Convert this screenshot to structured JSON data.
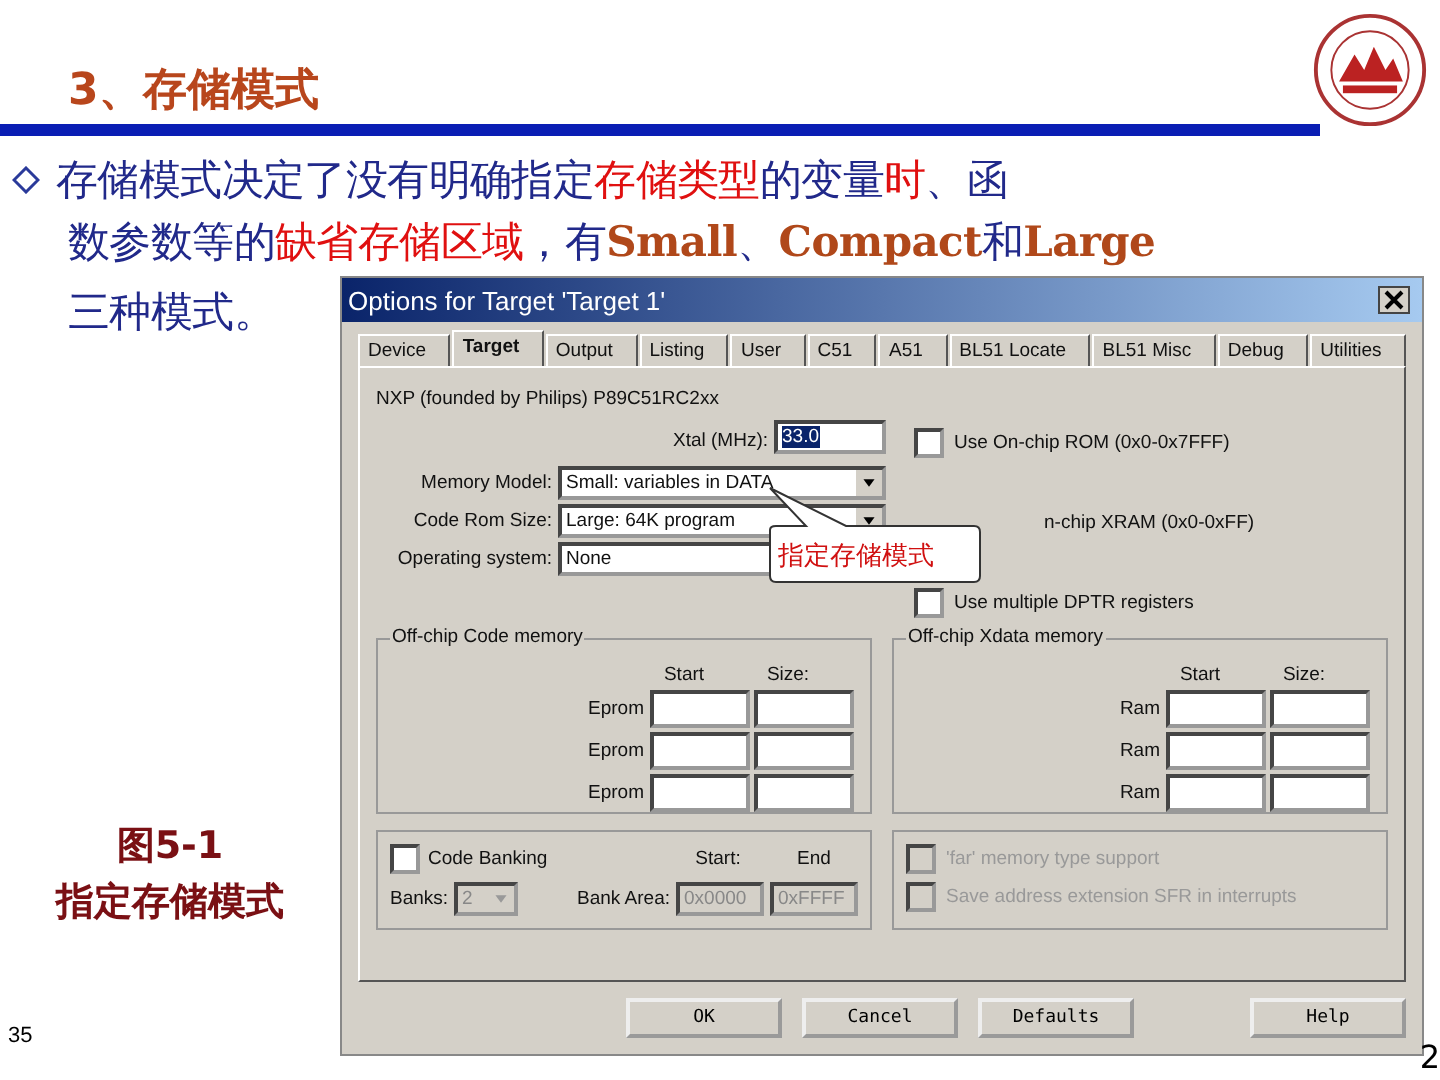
{
  "slide": {
    "title": "3、存储模式",
    "bullet_lines": [
      [
        {
          "kind": "plain",
          "text": "存储模式决定了没有明确指定"
        },
        {
          "kind": "red",
          "text": "存储类型"
        },
        {
          "kind": "plain",
          "text": "的变量"
        },
        {
          "kind": "red",
          "text": "时"
        },
        {
          "kind": "plain",
          "text": "、函"
        }
      ],
      [
        {
          "kind": "plain",
          "text": "数参数等的"
        },
        {
          "kind": "red",
          "text": "缺省存储区域"
        },
        {
          "kind": "plain",
          "text": "，有"
        },
        {
          "kind": "brown",
          "text": "Small"
        },
        {
          "kind": "plain",
          "text": "、"
        },
        {
          "kind": "brown",
          "text": "Compact"
        },
        {
          "kind": "plain",
          "text": "和"
        },
        {
          "kind": "brown",
          "text": "Large"
        }
      ],
      [
        {
          "kind": "plain",
          "text": "三种模式。"
        }
      ]
    ],
    "caption_lines": [
      "图5-1",
      "指定存储模式"
    ],
    "page_number": "35",
    "corner_number": "2"
  },
  "dialog": {
    "title": "Options for Target 'Target 1'",
    "tabs": [
      {
        "label": "Device",
        "selected": false
      },
      {
        "label": "Target",
        "selected": true
      },
      {
        "label": "Output",
        "selected": false
      },
      {
        "label": "Listing",
        "selected": false
      },
      {
        "label": "User",
        "selected": false
      },
      {
        "label": "C51",
        "selected": false
      },
      {
        "label": "A51",
        "selected": false
      },
      {
        "label": "BL51 Locate",
        "selected": false
      },
      {
        "label": "BL51 Misc",
        "selected": false
      },
      {
        "label": "Debug",
        "selected": false
      },
      {
        "label": "Utilities",
        "selected": false
      }
    ],
    "device": "NXP (founded by Philips) P89C51RC2xx",
    "xtal": {
      "label": "Xtal (MHz):",
      "value": "33.0"
    },
    "selects": [
      {
        "label": "Memory Model:",
        "value": "Small: variables in DATA"
      },
      {
        "label": "Code Rom Size:",
        "value": "Large: 64K program"
      },
      {
        "label": "Operating system:",
        "value": "None"
      }
    ],
    "checks": [
      {
        "kind": "full",
        "label": "Use On-chip ROM (0x0-0x7FFF)",
        "checked": false
      },
      {
        "kind": "covered",
        "label": "n-chip XRAM (0x0-0xFF)"
      },
      {
        "kind": "full",
        "label": "Use multiple DPTR registers",
        "checked": false
      }
    ],
    "callout": "指定存储模式",
    "groups": [
      {
        "title": "Off-chip Code memory",
        "columns": [
          "Start",
          "Size:"
        ],
        "rows": [
          "Eprom",
          "Eprom",
          "Eprom"
        ]
      },
      {
        "title": "Off-chip Xdata memory",
        "columns": [
          "Start",
          "Size:"
        ],
        "rows": [
          "Ram",
          "Ram",
          "Ram"
        ]
      }
    ],
    "banking": {
      "label": "Code Banking",
      "checked": false,
      "banks_label": "Banks:",
      "banks_value": "2",
      "start_label": "Start:",
      "end_label": "End",
      "area_label": "Bank Area:",
      "area_start": "0x0000",
      "area_end": "0xFFFF"
    },
    "options": [
      {
        "label": "'far' memory type support",
        "checked": false,
        "disabled": true
      },
      {
        "label": "Save address extension SFR in interrupts",
        "checked": false,
        "disabled": true
      }
    ],
    "buttons": [
      "OK",
      "Cancel",
      "Defaults"
    ],
    "help_button": "Help"
  }
}
